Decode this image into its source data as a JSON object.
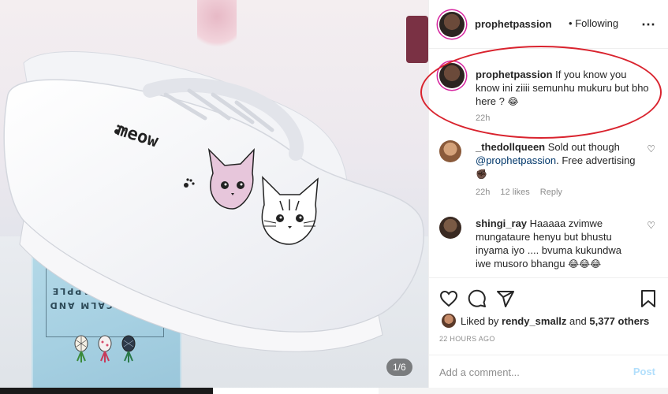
{
  "header": {
    "username": "prophetpassion",
    "separator": "•",
    "follow_status": "Following",
    "more_icon": "⋯"
  },
  "caption": {
    "username": "prophetpassion",
    "text": "If you know you know ini ziiii semunhu mukuru but bho here ?",
    "emoji": "😂",
    "time": "22h"
  },
  "comments": [
    {
      "username": "_thedollqueen",
      "text": "Sold out though",
      "mention": "@prophetpassion",
      "text2": ". Free advertising",
      "emoji": "✊🏿",
      "time": "22h",
      "likes": "12 likes",
      "reply": "Reply"
    },
    {
      "username": "shingi_ray",
      "text": "Haaaaa zvimwe mungataure henyu but bhustu inyama iyo .... bvuma kukundwa iwe musoro bhangu",
      "emoji": "😂😂😂"
    }
  ],
  "actions": {
    "like_icon": "heart-icon",
    "comment_icon": "comment-icon",
    "share_icon": "share-icon",
    "save_icon": "bookmark-icon"
  },
  "likes": {
    "prefix": "Liked by",
    "user": "rendy_smallz",
    "middle": "and",
    "count": "5,377 others"
  },
  "timestamp": "22 HOURS AGO",
  "add_comment": {
    "placeholder": "Add a comment...",
    "post_label": "Post"
  },
  "photo": {
    "counter": "1/6",
    "shoe_text": "meow",
    "box_text": "KEEP CALM AND EAT PINEAPPLE"
  },
  "colors": {
    "highlight_ring": "#d9232e",
    "link": "#00376b",
    "muted": "#8e8e8e",
    "post_disabled": "#b2dffc"
  }
}
